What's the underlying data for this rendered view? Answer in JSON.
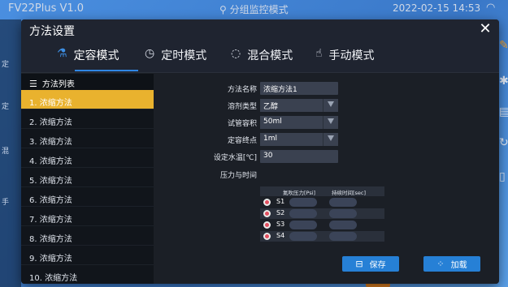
{
  "background": {
    "status_title": "FV22Plus V1.0",
    "status_mode": "⚲ 分组监控模式",
    "status_time": "2022-02-15 14:53",
    "left_items": [
      "定",
      "定",
      "混",
      "手"
    ]
  },
  "dialog": {
    "title": "方法设置",
    "close_label": "✕"
  },
  "tabs": [
    {
      "label": "定容模式",
      "icon": "flask-icon",
      "active": true
    },
    {
      "label": "定时模式",
      "icon": "clock-icon",
      "active": false
    },
    {
      "label": "混合模式",
      "icon": "spinner-icon",
      "active": false
    },
    {
      "label": "手动模式",
      "icon": "hand-icon",
      "active": false
    }
  ],
  "method_list": {
    "header": "方法列表",
    "items": [
      "1. 浓缩方法",
      "2. 浓缩方法",
      "3. 浓缩方法",
      "4. 浓缩方法",
      "5. 浓缩方法",
      "6. 浓缩方法",
      "7. 浓缩方法",
      "8. 浓缩方法",
      "9. 浓缩方法",
      "10. 浓缩方法"
    ],
    "selected_index": 0
  },
  "form": {
    "name_label": "方法名称",
    "name_value": "浓缩方法1",
    "solvent_label": "溶剂类型",
    "solvent_value": "乙醇",
    "tube_label": "试管容积",
    "tube_value": "50ml",
    "endpoint_label": "定容终点",
    "endpoint_value": "1ml",
    "temp_label": "设定水温[℃]",
    "temp_value": "30",
    "pressure_label": "压力与时间",
    "col_pressure": "氮吹压力[Psi]",
    "col_duration": "持续时间[sec]",
    "stages": [
      {
        "label": "S1",
        "pressure": "",
        "duration": ""
      },
      {
        "label": "S2",
        "pressure": "",
        "duration": ""
      },
      {
        "label": "S3",
        "pressure": "",
        "duration": ""
      },
      {
        "label": "S4",
        "pressure": "",
        "duration": ""
      }
    ]
  },
  "buttons": {
    "save": "保存",
    "load": "加载"
  },
  "colors": {
    "accent": "#2680d6",
    "selected_item": "#e9b22e",
    "checkbox": "#e24e5f"
  }
}
